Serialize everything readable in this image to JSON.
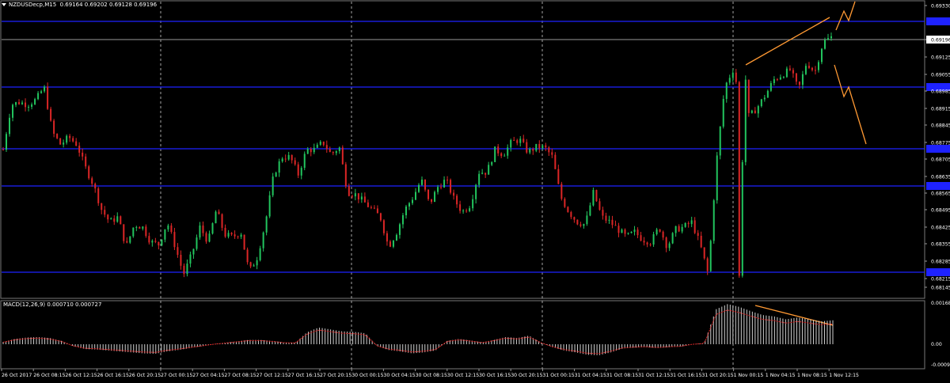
{
  "window": {
    "symbol_title": "NZDUSDecp,M15",
    "ohlc": "0.69164 0.69202 0.69128 0.69196"
  },
  "macd": {
    "title": "MACD(12,26,9) 0.000710 0.000727",
    "scale_top": "0.001686",
    "scale_zero": "0.00",
    "scale_bottom": "-0.000957",
    "data": [
      0.0001,
      0.00022,
      0.00028,
      0.0003,
      0.00026,
      0.00014,
      -8e-05,
      -0.0002,
      -0.00022,
      -0.00026,
      -0.0003,
      -0.00034,
      -0.00038,
      -0.0004,
      -0.0003,
      -0.00024,
      -0.00016,
      -8e-05,
      0.0,
      6e-05,
      0.00012,
      0.00018,
      0.00018,
      0.00014,
      8e-05,
      6e-05,
      0.0005,
      0.0007,
      0.00062,
      0.00054,
      0.00052,
      0.00046,
      -8e-05,
      -0.00024,
      -0.0003,
      -0.00038,
      -0.00034,
      -0.00026,
      0.00014,
      0.00022,
      0.00016,
      8e-05,
      0.00018,
      0.0003,
      0.00026,
      0.00036,
      8e-05,
      -0.00012,
      -0.00026,
      -0.00034,
      -0.00044,
      -0.00046,
      -0.00034,
      -0.00018,
      -0.00014,
      -0.00012,
      -0.00016,
      -0.00012,
      -0.0001,
      0.0,
      4e-05,
      0.00146,
      0.00168,
      0.00156,
      0.00138,
      0.00122,
      0.00116,
      0.00104,
      0.00112,
      0.00104,
      0.00096,
      0.001
    ]
  },
  "price_axis": {
    "labels": [
      "0.69330",
      "0.69196",
      "0.69125",
      "0.69055",
      "0.68985",
      "0.68915",
      "0.68845",
      "0.68775",
      "0.68705",
      "0.68635",
      "0.68565",
      "0.68495",
      "0.68425",
      "0.68355",
      "0.68285",
      "0.68215",
      "0.68145"
    ],
    "current_price": "0.69196",
    "hline_tags": [
      "0.69267",
      "0.69004",
      "0.68764",
      "0.68616",
      "0.68253"
    ]
  },
  "time_axis": {
    "labels": [
      "26 Oct 2017",
      "26 Oct 08:15",
      "26 Oct 12:15",
      "26 Oct 16:15",
      "26 Oct 20:15",
      "27 Oct 00:15",
      "27 Oct 04:15",
      "27 Oct 08:15",
      "27 Oct 12:15",
      "27 Oct 16:15",
      "27 Oct 20:15",
      "30 Oct 00:15",
      "30 Oct 04:15",
      "30 Oct 08:15",
      "30 Oct 12:15",
      "30 Oct 16:15",
      "30 Oct 20:15",
      "31 Oct 00:15",
      "31 Oct 04:15",
      "31 Oct 08:15",
      "31 Oct 12:15",
      "31 Oct 16:15",
      "31 Oct 20:15",
      "1 Nov 00:15",
      "1 Nov 04:15",
      "1 Nov 08:15",
      "1 Nov 12:15"
    ]
  },
  "colors": {
    "background": "#000000",
    "bull": "#22c55e",
    "bear": "#dc2626",
    "hline": "#1e22ff",
    "trend": "#ff9933",
    "grid": "#cccccc",
    "macd_hist": "#d0d0d0",
    "macd_signal": "#dc2626"
  },
  "chart_data": {
    "type": "candlestick",
    "title": "NZDUSDecp,M15",
    "ylim": [
      0.68145,
      0.6933
    ],
    "price_points": [
      [
        0,
        0.6875
      ],
      [
        1,
        0.6893
      ],
      [
        2,
        0.6894
      ],
      [
        3,
        0.6893
      ],
      [
        4,
        0.6895
      ],
      [
        5,
        0.69
      ],
      [
        6,
        0.6882
      ],
      [
        7,
        0.6877
      ],
      [
        8,
        0.688
      ],
      [
        9,
        0.6877
      ],
      [
        10,
        0.6868
      ],
      [
        11,
        0.6861
      ],
      [
        12,
        0.6851
      ],
      [
        13,
        0.6846
      ],
      [
        14,
        0.6848
      ],
      [
        15,
        0.6836
      ],
      [
        16,
        0.6845
      ],
      [
        17,
        0.6844
      ],
      [
        18,
        0.6838
      ],
      [
        19,
        0.6837
      ],
      [
        20,
        0.6846
      ],
      [
        21,
        0.6836
      ],
      [
        22,
        0.6825
      ],
      [
        23,
        0.6833
      ],
      [
        24,
        0.6844
      ],
      [
        25,
        0.6838
      ],
      [
        26,
        0.6851
      ],
      [
        27,
        0.6841
      ],
      [
        28,
        0.684
      ],
      [
        29,
        0.6842
      ],
      [
        30,
        0.6826
      ],
      [
        31,
        0.6832
      ],
      [
        32,
        0.6846
      ],
      [
        33,
        0.6865
      ],
      [
        34,
        0.6872
      ],
      [
        35,
        0.6872
      ],
      [
        36,
        0.6865
      ],
      [
        37,
        0.6875
      ],
      [
        38,
        0.6875
      ],
      [
        39,
        0.6878
      ],
      [
        40,
        0.6873
      ],
      [
        41,
        0.6876
      ],
      [
        42,
        0.6858
      ],
      [
        43,
        0.6857
      ],
      [
        44,
        0.6854
      ],
      [
        45,
        0.6851
      ],
      [
        46,
        0.6848
      ],
      [
        47,
        0.6836
      ],
      [
        48,
        0.6842
      ],
      [
        49,
        0.6851
      ],
      [
        50,
        0.6856
      ],
      [
        51,
        0.6863
      ],
      [
        52,
        0.6853
      ],
      [
        53,
        0.686
      ],
      [
        54,
        0.6863
      ],
      [
        55,
        0.6855
      ],
      [
        56,
        0.685
      ],
      [
        57,
        0.6853
      ],
      [
        58,
        0.6866
      ],
      [
        59,
        0.6866
      ],
      [
        60,
        0.6875
      ],
      [
        61,
        0.6873
      ],
      [
        62,
        0.6878
      ],
      [
        63,
        0.6879
      ],
      [
        64,
        0.6874
      ],
      [
        65,
        0.6876
      ],
      [
        66,
        0.6876
      ],
      [
        67,
        0.6872
      ],
      [
        68,
        0.6856
      ],
      [
        69,
        0.685
      ],
      [
        70,
        0.6846
      ],
      [
        71,
        0.6845
      ],
      [
        72,
        0.6858
      ],
      [
        73,
        0.6848
      ],
      [
        74,
        0.6846
      ],
      [
        75,
        0.6843
      ],
      [
        76,
        0.684
      ],
      [
        77,
        0.6842
      ],
      [
        78,
        0.6839
      ],
      [
        79,
        0.6838
      ],
      [
        80,
        0.6844
      ],
      [
        81,
        0.6836
      ],
      [
        82,
        0.6843
      ],
      [
        83,
        0.6844
      ],
      [
        84,
        0.6846
      ],
      [
        85,
        0.6837
      ],
      [
        86,
        0.6825
      ],
      [
        87,
        0.687
      ],
      [
        88,
        0.69
      ],
      [
        89,
        0.6907
      ],
      [
        90,
        0.6895
      ],
      [
        91,
        0.6888
      ],
      [
        92,
        0.6892
      ],
      [
        93,
        0.6897
      ],
      [
        94,
        0.6903
      ],
      [
        95,
        0.6905
      ],
      [
        96,
        0.6907
      ],
      [
        97,
        0.6899
      ],
      [
        98,
        0.691
      ],
      [
        99,
        0.6906
      ],
      [
        100,
        0.6918
      ],
      [
        101,
        0.692
      ]
    ],
    "horizontal_levels": [
      0.69267,
      0.69004,
      0.68764,
      0.68616,
      0.68253
    ],
    "vertical_separators": [
      "27 Oct 00:15",
      "30 Oct 00:15",
      "31 Oct 00:15",
      "1 Nov 00:15"
    ]
  }
}
